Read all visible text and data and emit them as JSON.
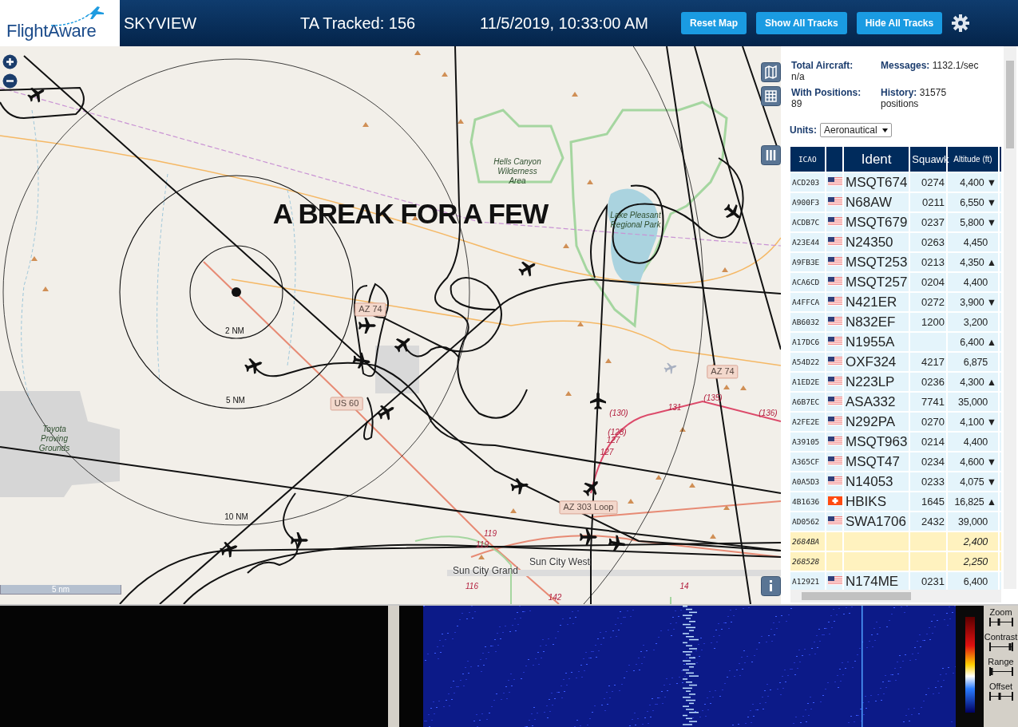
{
  "header": {
    "logo": "FlightAware",
    "title": "SKYVIEW",
    "tracked": "TA Tracked: 156",
    "datetime": "11/5/2019, 10:33:00 AM",
    "buttons": [
      "Reset Map",
      "Show All Tracks",
      "Hide All Tracks"
    ]
  },
  "map": {
    "caption": "A BREAK FOR A FEW",
    "scale": "5 nm",
    "labels": [
      {
        "kind": "place",
        "text": "Hells Canyon Wilderness Area"
      },
      {
        "kind": "place",
        "text": "Lake Pleasant Regional Park"
      },
      {
        "kind": "place",
        "text": "Toyota Proving Grounds"
      },
      {
        "kind": "ring",
        "text": "2 NM"
      },
      {
        "kind": "ring",
        "text": "5 NM"
      },
      {
        "kind": "ring",
        "text": "10 NM"
      },
      {
        "kind": "road",
        "text": "AZ 74"
      },
      {
        "kind": "road",
        "text": "AZ 74"
      },
      {
        "kind": "road",
        "text": "US 60"
      },
      {
        "kind": "road",
        "text": "AZ 303 Loop"
      },
      {
        "kind": "route",
        "text": "(130)"
      },
      {
        "kind": "route",
        "text": "131"
      },
      {
        "kind": "route",
        "text": "(135)"
      },
      {
        "kind": "route",
        "text": "(136)"
      },
      {
        "kind": "route",
        "text": "(128)"
      },
      {
        "kind": "route",
        "text": "127"
      },
      {
        "kind": "route",
        "text": "127"
      },
      {
        "kind": "route",
        "text": "119"
      },
      {
        "kind": "route",
        "text": "119"
      },
      {
        "kind": "route",
        "text": "116"
      },
      {
        "kind": "route",
        "text": "142"
      },
      {
        "kind": "route",
        "text": "14"
      },
      {
        "kind": "town",
        "text": "Sun City Grand"
      },
      {
        "kind": "town",
        "text": "Sun City West"
      }
    ]
  },
  "stats": [
    {
      "label": "Total Aircraft:",
      "value": "n/a"
    },
    {
      "label": "Messages:",
      "value": "1132.1/sec"
    },
    {
      "label": "With Positions:",
      "value": "89"
    },
    {
      "label": "History:",
      "value": "31575 positions"
    }
  ],
  "units": {
    "label": "Units:",
    "value": "Aeronautical"
  },
  "table": {
    "columns": [
      "ICAO",
      "Ident",
      "Squawk",
      "Altitude (ft)"
    ],
    "rows": [
      {
        "icao": "ACD203",
        "kind": "us",
        "ident": "MSQT674",
        "squawk": "0274",
        "altitude": "4,400",
        "trend": "▼",
        "highlighted": false
      },
      {
        "icao": "A900F3",
        "kind": "us",
        "ident": "N68AW",
        "squawk": "0211",
        "altitude": "6,550",
        "trend": "▼",
        "highlighted": false
      },
      {
        "icao": "ACDB7C",
        "kind": "us",
        "ident": "MSQT679",
        "squawk": "0237",
        "altitude": "5,800",
        "trend": "▼",
        "highlighted": false
      },
      {
        "icao": "A23E44",
        "kind": "us",
        "ident": "N24350",
        "squawk": "0263",
        "altitude": "4,450",
        "highlighted": false
      },
      {
        "icao": "A9FB3E",
        "kind": "us",
        "ident": "MSQT253",
        "squawk": "0213",
        "altitude": "4,350",
        "trend": "▲",
        "highlighted": false
      },
      {
        "icao": "ACA6CD",
        "kind": "us",
        "ident": "MSQT257",
        "squawk": "0204",
        "altitude": "4,400",
        "highlighted": false
      },
      {
        "icao": "A4FFCA",
        "kind": "us",
        "ident": "N421ER",
        "squawk": "0272",
        "altitude": "3,900",
        "trend": "▼",
        "highlighted": false
      },
      {
        "icao": "AB6032",
        "kind": "us",
        "ident": "N832EF",
        "squawk": "1200",
        "altitude": "3,200",
        "highlighted": false
      },
      {
        "icao": "A17DC6",
        "kind": "us",
        "ident": "N1955A",
        "altitude": "6,400",
        "trend": "▲",
        "highlighted": false
      },
      {
        "icao": "A54D22",
        "kind": "us",
        "ident": "OXF324",
        "squawk": "4217",
        "altitude": "6,875",
        "highlighted": false
      },
      {
        "icao": "A1ED2E",
        "kind": "us",
        "ident": "N223LP",
        "squawk": "0236",
        "altitude": "4,300",
        "trend": "▲",
        "highlighted": false
      },
      {
        "icao": "A6B7EC",
        "kind": "us",
        "ident": "ASA332",
        "squawk": "7741",
        "altitude": "35,000",
        "highlighted": false
      },
      {
        "icao": "A2FE2E",
        "kind": "us",
        "ident": "N292PA",
        "squawk": "0270",
        "altitude": "4,100",
        "trend": "▼",
        "highlighted": false
      },
      {
        "icao": "A39105",
        "kind": "us",
        "ident": "MSQT963",
        "squawk": "0214",
        "altitude": "4,400",
        "highlighted": false
      },
      {
        "icao": "A365CF",
        "kind": "us",
        "ident": "MSQT47",
        "squawk": "0234",
        "altitude": "4,600",
        "trend": "▼",
        "highlighted": false
      },
      {
        "icao": "A0A5D3",
        "kind": "us",
        "ident": "N14053",
        "squawk": "0233",
        "altitude": "4,075",
        "trend": "▼",
        "highlighted": false
      },
      {
        "icao": "4B1636",
        "kind": "ch",
        "ident": "HBIKS",
        "squawk": "1645",
        "altitude": "16,825",
        "trend": "▲",
        "highlighted": false
      },
      {
        "icao": "AD0562",
        "kind": "us",
        "ident": "SWA1706",
        "squawk": "2432",
        "altitude": "39,000",
        "highlighted": false
      },
      {
        "icao": "2684BA",
        "kind": "none",
        "altitude": "2,400",
        "highlighted": true
      },
      {
        "icao": "268528",
        "kind": "none",
        "altitude": "2,250",
        "highlighted": true
      },
      {
        "icao": "A12921",
        "kind": "us",
        "ident": "N174ME",
        "squawk": "0231",
        "altitude": "6,400",
        "highlighted": false
      }
    ]
  },
  "spectrum": {
    "controls": [
      {
        "label": "Zoom",
        "level": 0.4
      },
      {
        "label": "Contrast",
        "level": 0.95
      },
      {
        "label": "Range",
        "level": 0.05
      },
      {
        "label": "Offset",
        "level": 0.45
      }
    ]
  }
}
